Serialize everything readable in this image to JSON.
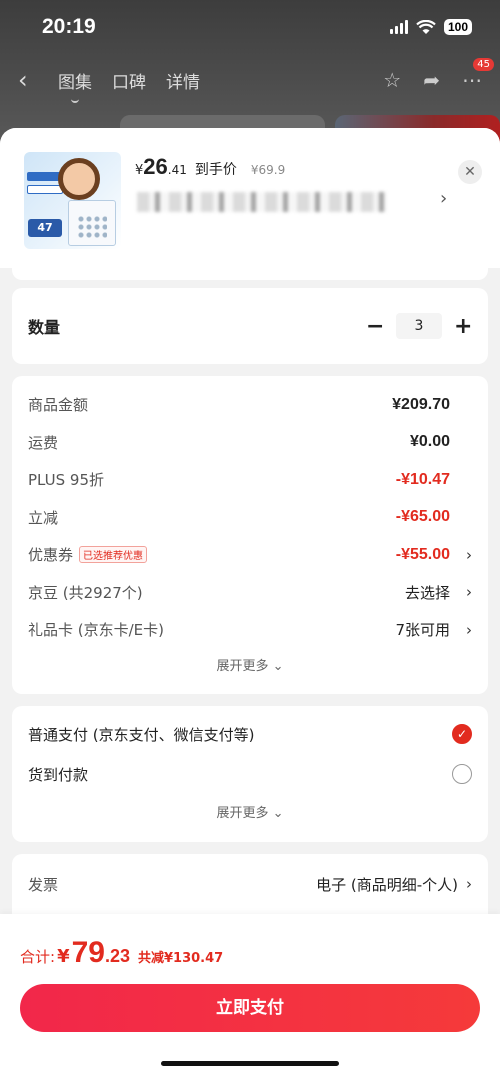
{
  "status_bar": {
    "time": "20:19",
    "battery": "100"
  },
  "nav": {
    "tabs": [
      "图集",
      "口碑",
      "详情"
    ],
    "badge": "45"
  },
  "product": {
    "yen": "¥",
    "price_int": "26",
    "price_dec": ".41",
    "price_label": "到手价",
    "original_price": "¥69.9",
    "thumb_tag": "47"
  },
  "quantity": {
    "label": "数量",
    "value": "3",
    "minus": "−",
    "plus": "+"
  },
  "amounts": [
    {
      "label": "商品金额",
      "value": "¥209.70",
      "style": "bold",
      "chevron": false
    },
    {
      "label": "运费",
      "value": "¥0.00",
      "style": "bold",
      "chevron": false
    },
    {
      "label": "PLUS 95折",
      "value": "-¥10.47",
      "style": "red",
      "chevron": false
    },
    {
      "label": "立减",
      "value": "-¥65.00",
      "style": "red",
      "chevron": false
    },
    {
      "label": "优惠券",
      "tag": "已选推荐优惠",
      "value": "-¥55.00",
      "style": "red",
      "chevron": true
    },
    {
      "label": "京豆 (共2927个)",
      "value": "去选择",
      "style": "normal",
      "chevron": true
    },
    {
      "label": "礼品卡 (京东卡/E卡)",
      "value": "7张可用",
      "style": "normal",
      "chevron": true
    }
  ],
  "expand_more": "展开更多",
  "payment": {
    "options": [
      {
        "label": "普通支付 (京东支付、微信支付等)",
        "selected": true
      },
      {
        "label": "货到付款",
        "selected": false
      }
    ],
    "expand_more": "展开更多"
  },
  "invoice": {
    "label": "发票",
    "value": "电子 (商品明细-个人)"
  },
  "footer": {
    "total_label": "合计:",
    "total_yen": "¥",
    "total_int": "79",
    "total_dec": ".23",
    "saved": "共减¥130.47",
    "pay_button": "立即支付"
  },
  "colors": {
    "accent_red": "#e22b1f",
    "button_red": "#f2274a"
  },
  "icons": [
    "back-icon",
    "star-icon",
    "share-icon",
    "more-icon",
    "close-icon",
    "chevron-right-icon",
    "checkmark-icon"
  ]
}
